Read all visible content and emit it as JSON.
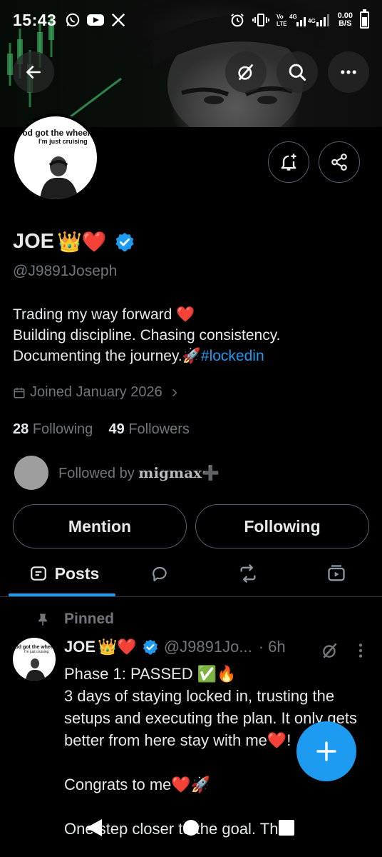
{
  "status_bar": {
    "time": "15:43",
    "left_icons": [
      "whatsapp-icon",
      "youtube-icon",
      "x-icon"
    ],
    "network_labels": "Vo LTE 4G 4G",
    "net_speed_value": "0.00",
    "net_speed_unit": "B/S"
  },
  "profile": {
    "avatar_text_line1": "God got the wheel",
    "avatar_text_line2": "I'm just cruising",
    "name": "JOE",
    "name_emojis": "👑❤️",
    "handle": "@J9891Joseph",
    "bio_line1": "Trading my way forward ❤️",
    "bio_line2": "Building discipline. Chasing consistency.",
    "bio_line3_text": "Documenting the journey.🚀",
    "bio_hashtag": "#lockedin",
    "joined": "Joined January 2026",
    "following_count": "28",
    "following_label": "Following",
    "followers_count": "49",
    "followers_label": "Followers",
    "followed_by_prefix": "Followed by",
    "followed_by_name": "migmax➕",
    "mention_button": "Mention",
    "following_button": "Following"
  },
  "tabs": [
    {
      "label": "Posts",
      "active": true
    },
    {
      "label": "",
      "icon": "reply-icon"
    },
    {
      "label": "",
      "icon": "repost-icon"
    },
    {
      "label": "",
      "icon": "media-icon"
    }
  ],
  "pinned_post": {
    "pinned_label": "Pinned",
    "author_name": "JOE",
    "author_emojis": "👑❤️",
    "author_handle": "@J9891Jo...",
    "time_ago": "· 6h",
    "body": "Phase 1: PASSED ✅🔥\n3 days of staying locked in, trusting the setups and executing the plan. It only gets better from here stay with me❤️!\n\nCongrats to me❤️🚀\n\nOne step closer to the goal. This"
  },
  "colors": {
    "accent": "#1d9bf0",
    "secondary_text": "#71767b",
    "background": "#000000"
  }
}
